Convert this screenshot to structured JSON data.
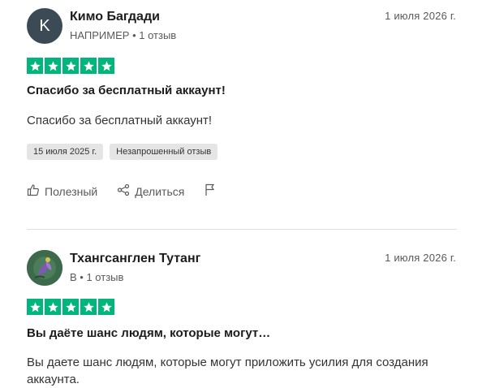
{
  "reviews": [
    {
      "avatar_letter": "K",
      "name": "Кимо Багдади",
      "country": "НАПРИМЕР",
      "review_count": "1 отзыв",
      "date": "1 июля 2026 г.",
      "rating": 5,
      "title": "Спасибо за бесплатный аккаунт!",
      "body": "Спасибо за бесплатный аккаунт!",
      "experience_date": "15 июля 2025 г.",
      "tag": "Незапрошенный отзыв",
      "useful_label": "Полезный",
      "share_label": "Делиться"
    },
    {
      "name": "Тхангсанглен Тутанг",
      "country": "В",
      "review_count": "1 отзыв",
      "date": "1 июля 2026 г.",
      "rating": 5,
      "title": "Вы даёте шанс людям, которые могут…",
      "body": "Вы даете шанс людям, которые могут приложить усилия для создания аккаунта."
    }
  ],
  "colors": {
    "star_green": "#00b67a",
    "avatar_dark": "#3b4a55"
  },
  "icons": {
    "star": "star-icon",
    "like": "thumbs-up-icon",
    "share": "share-icon",
    "flag": "flag-icon"
  }
}
